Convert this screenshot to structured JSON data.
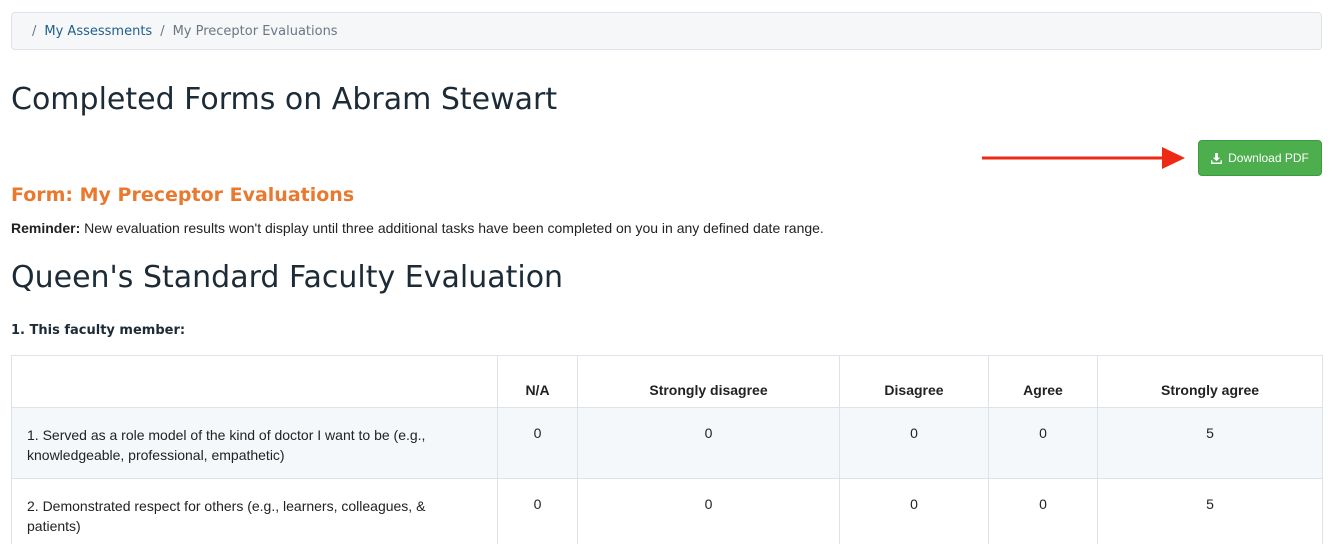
{
  "breadcrumb": {
    "items": [
      "My Assessments",
      "My Preceptor Evaluations"
    ]
  },
  "page_title": "Completed Forms on Abram Stewart",
  "download_button": {
    "label": "Download PDF",
    "icon": "download-icon"
  },
  "annotation": {
    "arrow_color": "#ee2a14"
  },
  "form_title": "Form: My Preceptor Evaluations",
  "reminder": {
    "label": "Reminder:",
    "text": " New evaluation results won't display until three additional tasks have been completed on you in any defined date range."
  },
  "section_title": "Queen's Standard Faculty Evaluation",
  "question": "1. This faculty member:",
  "table": {
    "headers": [
      "",
      "N/A",
      "Strongly disagree",
      "Disagree",
      "Agree",
      "Strongly agree"
    ],
    "rows": [
      {
        "question": "1. Served as a role model of the kind of doctor I want to be (e.g., knowledgeable, professional, empathetic)",
        "values": [
          "0",
          "0",
          "0",
          "0",
          "5"
        ]
      },
      {
        "question": "2. Demonstrated respect for others (e.g., learners, colleagues, & patients)",
        "values": [
          "0",
          "0",
          "0",
          "0",
          "5"
        ]
      }
    ]
  },
  "colors": {
    "link": "#1f5f8b",
    "heading": "#1c2b36",
    "form_title": "#e8792f",
    "button_green": "#4cae4c",
    "row_stripe": "#f4f8fb"
  }
}
